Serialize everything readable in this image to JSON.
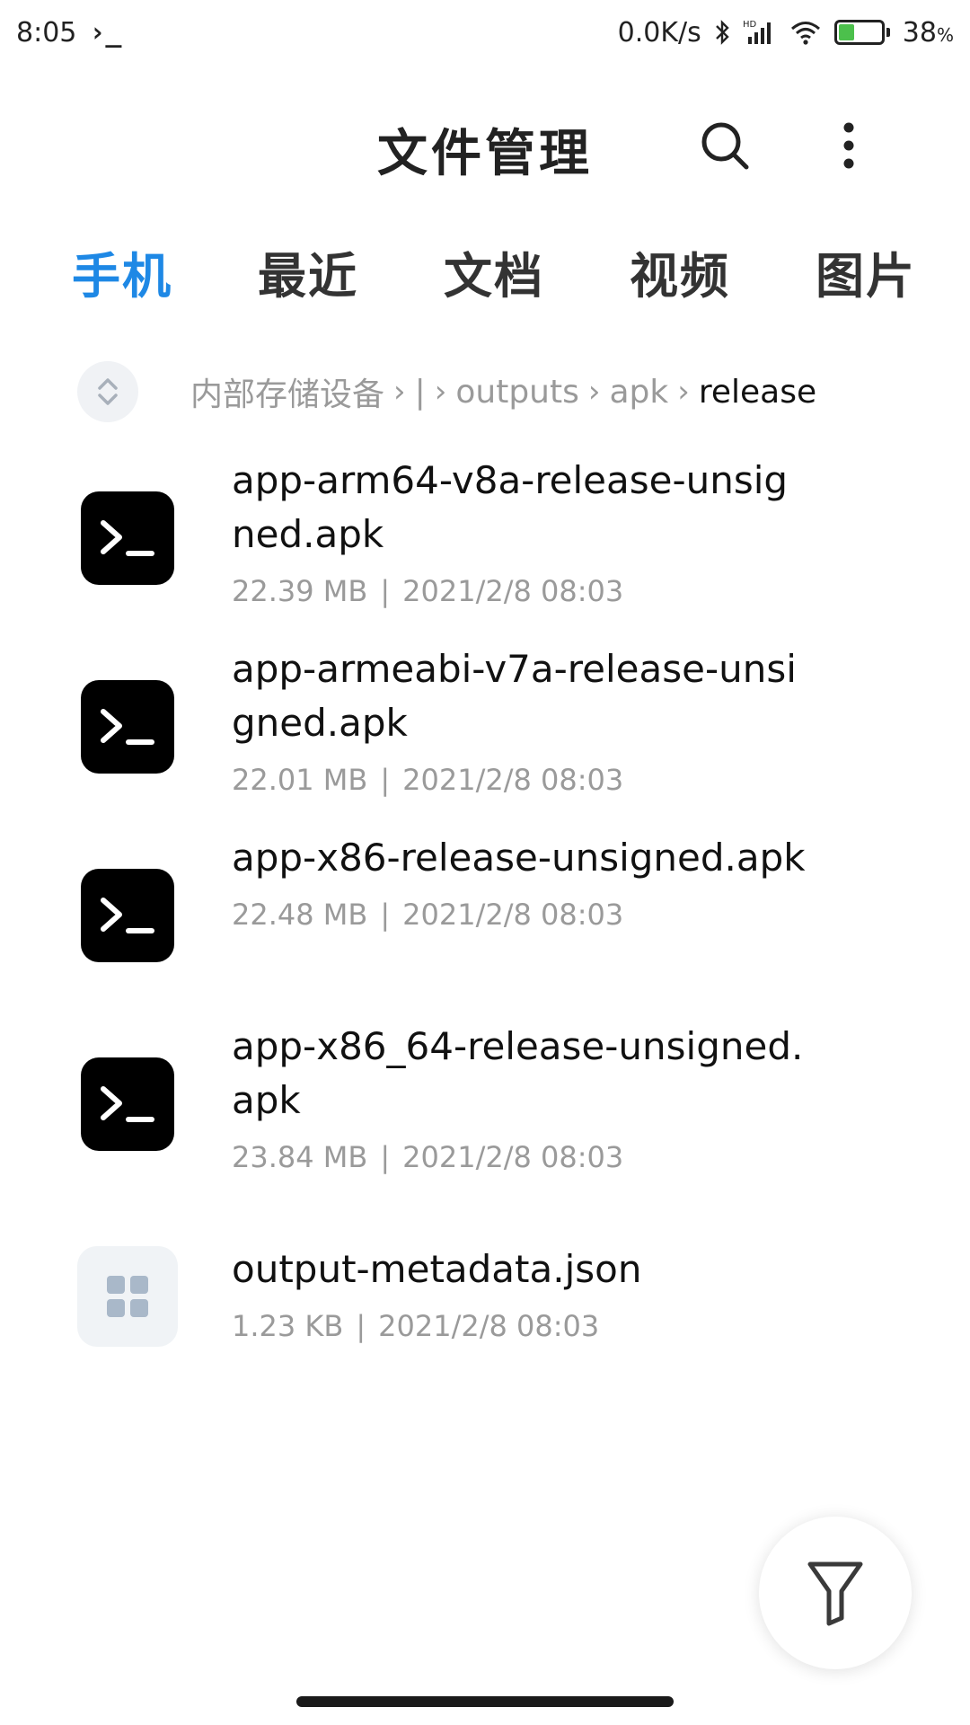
{
  "status_bar": {
    "time": "8:05",
    "terminal_glyph": "›_",
    "net_speed": "0.0K/s",
    "battery_percent": "38",
    "battery_unit": "%",
    "battery_level": 0.38
  },
  "header": {
    "title": "文件管理"
  },
  "tabs": [
    {
      "label": "手机",
      "active": true
    },
    {
      "label": "最近",
      "active": false
    },
    {
      "label": "文档",
      "active": false
    },
    {
      "label": "视频",
      "active": false
    },
    {
      "label": "图片",
      "active": false
    }
  ],
  "breadcrumb": [
    {
      "label": "内部存储设备"
    },
    {
      "label": "|"
    },
    {
      "label": "outputs"
    },
    {
      "label": "apk"
    },
    {
      "label": "release"
    }
  ],
  "files": [
    {
      "name": "app-arm64-v8a-release-unsigned.apk",
      "size": "22.39 MB",
      "date": "2021/2/8 08:03",
      "icon": "terminal-icon"
    },
    {
      "name": "app-armeabi-v7a-release-unsigned.apk",
      "size": "22.01 MB",
      "date": "2021/2/8 08:03",
      "icon": "terminal-icon"
    },
    {
      "name": "app-x86-release-unsigned.apk",
      "size": "22.48 MB",
      "date": "2021/2/8 08:03",
      "icon": "terminal-icon"
    },
    {
      "name": "app-x86_64-release-unsigned.apk",
      "size": "23.84 MB",
      "date": "2021/2/8 08:03",
      "icon": "terminal-icon"
    },
    {
      "name": "output-metadata.json",
      "size": "1.23 KB",
      "date": "2021/2/8 08:03",
      "icon": "file-grid-icon"
    }
  ],
  "meta_separator": "|",
  "colors": {
    "accent": "#1e88e5",
    "text": "#111111",
    "muted": "#9a9a9a"
  }
}
